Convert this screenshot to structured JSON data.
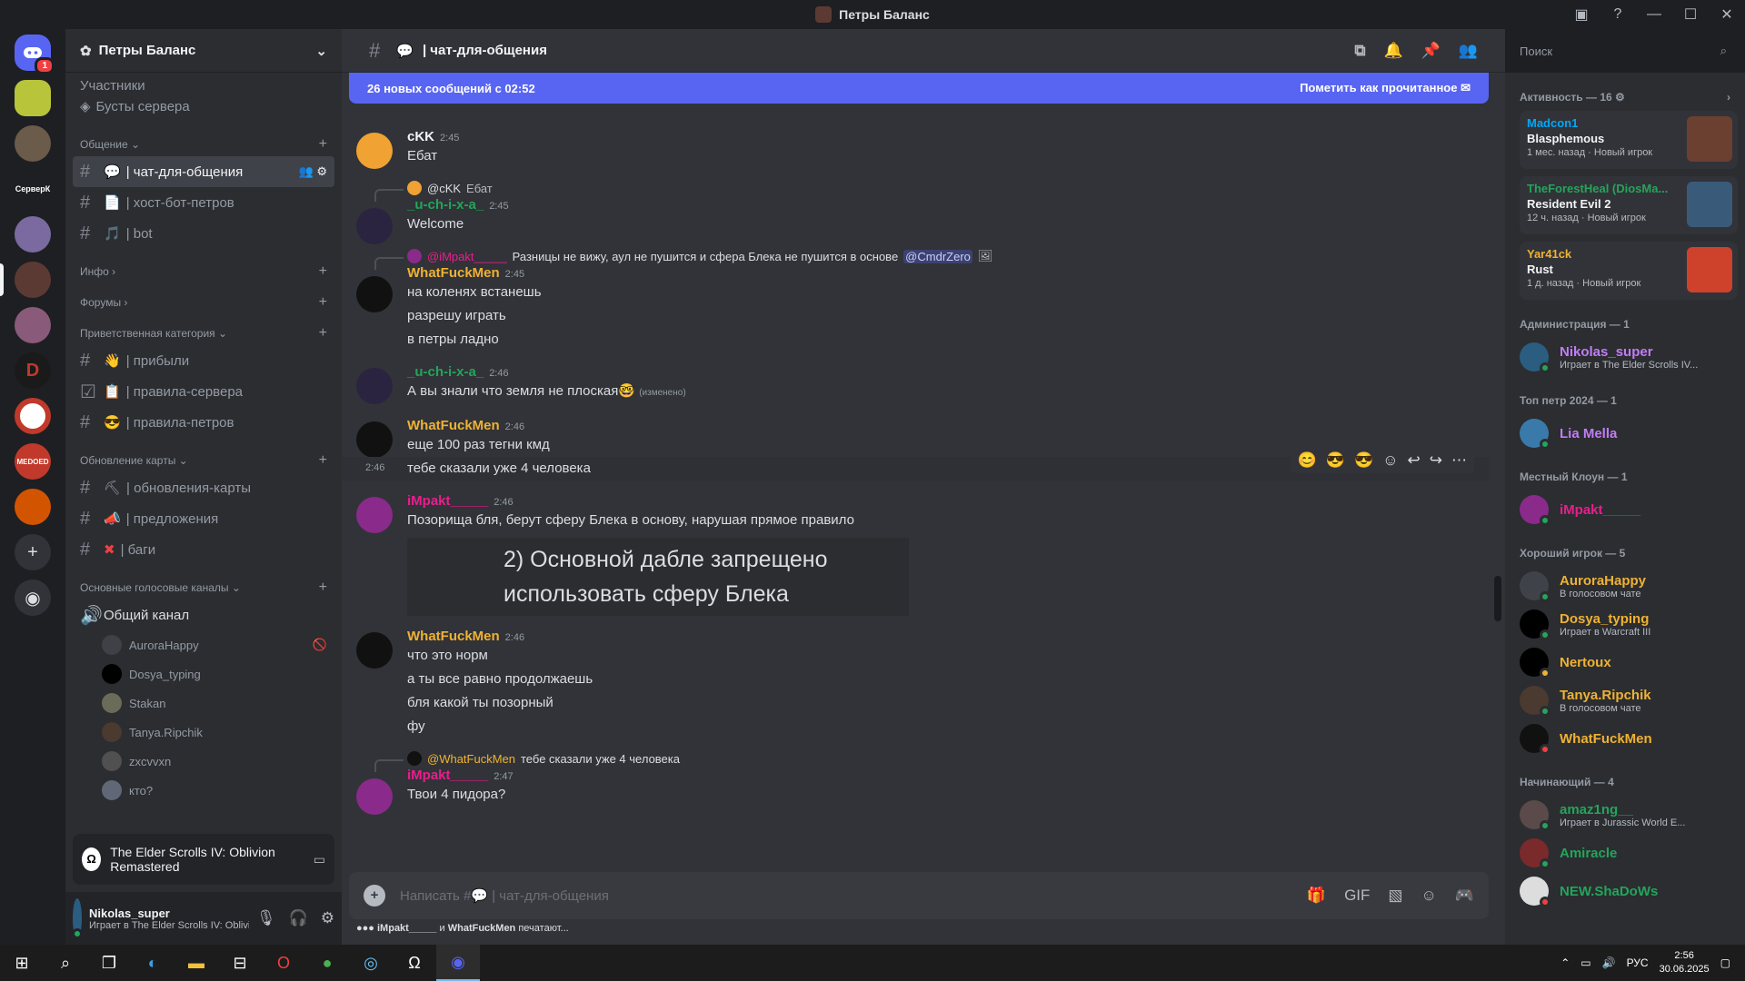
{
  "window": {
    "title": "Петры Баланс"
  },
  "guilds": [
    {
      "name": "home",
      "badge": "1"
    },
    {
      "name": "yellow-server"
    },
    {
      "name": "photo-server-1"
    },
    {
      "name": "text-server",
      "label": "СерверК"
    },
    {
      "name": "anime-server-1"
    },
    {
      "name": "petry-balans-server"
    },
    {
      "name": "anime-server-2"
    },
    {
      "name": "diablo-server"
    },
    {
      "name": "circle-server"
    },
    {
      "name": "medoed-server"
    },
    {
      "name": "red-server"
    }
  ],
  "sidebar": {
    "server_name": "Петры Баланс",
    "boosts": "Бусты сервера",
    "truncated_top": "Участники",
    "categories": {
      "obshenie": "Общение",
      "info": "Инфо",
      "forums": "Форумы",
      "welcome": "Приветственная категория",
      "map_updates": "Обновление карты",
      "voice": "Основные голосовые каналы"
    },
    "channels": {
      "chat": "| чат-для-общения",
      "host_bot": "| хост-бот-петров",
      "bot": "| bot",
      "arrived": "| прибыли",
      "server_rules": "| правила-сервера",
      "petr_rules": "| правила-петров",
      "map_updates": "| обновления-карты",
      "suggestions": "| предложения",
      "bugs": "| баги",
      "general_voice": "Общий канал"
    },
    "voice_users": [
      "AuroraHappy",
      "Dosya_typing",
      "Stakan",
      "Tanya.Ripchik",
      "zxcvvxn",
      "кто?"
    ],
    "activity": "The Elder Scrolls IV: Oblivion Remastered",
    "user": {
      "name": "Nikolas_super",
      "status": "Играет в The Elder Scrolls IV: Oblivion Remastered"
    }
  },
  "chat": {
    "channel": "| чат-для-общения",
    "banner": "26 новых сообщений с 02:52",
    "mark_read": "Пометить как прочитанное",
    "placeholder": "Написать #💬 | чат-для-общения",
    "typing_users": "iMpakt_____",
    "typing_and": "и",
    "typing_user2": "WhatFuckMen",
    "typing_suffix": "печатают...",
    "messages": [
      {
        "author": "cKK",
        "color": "#f2f3f5",
        "time": "2:45",
        "lines": [
          "Ебат"
        ]
      },
      {
        "reply_to": "@cKK",
        "reply_text": "Ебат",
        "author": "_u-ch-i-x-a_",
        "color": "#23a55a",
        "time": "2:45",
        "lines": [
          "Welcome"
        ]
      },
      {
        "reply_to": "@iMpakt_____",
        "reply_text": "Разницы не вижу, аул не пушится и сфера Блека не пушится в основе",
        "reply_mention": "@CmdrZero",
        "author": "WhatFuckMen",
        "color": "#f0b232",
        "time": "2:45",
        "lines": [
          "на коленях встанешь",
          "разрешу играть",
          "в петры ладно"
        ]
      },
      {
        "author": "_u-ch-i-x-a_",
        "color": "#23a55a",
        "time": "2:46",
        "lines": [
          "А вы знали что земля не плоская🤓"
        ],
        "edited": "(изменено)"
      },
      {
        "author": "WhatFuckMen",
        "color": "#f0b232",
        "time": "2:46",
        "lines": [
          "еще 100 раз тегни кмд"
        ],
        "extra_time": "2:46",
        "extra_line": "тебе сказали уже 4 человека"
      },
      {
        "author": "iMpakt_____",
        "color": "#e91e8c",
        "time": "2:46",
        "lines": [
          "Позорища бля, берут сферу Блека в основу, нарушая прямое правило"
        ],
        "image_text": [
          "2) Основной дабле запрещено",
          "использовать сферу Блека"
        ]
      },
      {
        "author": "WhatFuckMen",
        "color": "#f0b232",
        "time": "2:46",
        "lines": [
          "что это норм",
          "а ты все равно продолжаешь",
          "бля какой ты позорный",
          "фу"
        ]
      },
      {
        "reply_to": "@WhatFuckMen",
        "reply_text": "тебе сказали уже 4 человека",
        "author": "iMpakt_____",
        "color": "#e91e8c",
        "time": "2:47",
        "lines": [
          "Твои 4 пидора?"
        ]
      }
    ]
  },
  "search": {
    "placeholder": "Поиск"
  },
  "members": {
    "activity_header": "Активность — 16",
    "activities": [
      {
        "who": "Madcon1",
        "color": "#00a8fc",
        "game": "Blasphemous",
        "meta": "1 мес. назад",
        "tag": "Новый игрок"
      },
      {
        "who": "TheForestHeal (DiosMa...",
        "color": "#23a55a",
        "game": "Resident Evil 2",
        "meta": "12 ч. назад",
        "tag": "Новый игрок"
      },
      {
        "who": "Yar41ck",
        "color": "#f0b232",
        "game": "Rust",
        "meta": "1 д. назад",
        "tag": "Новый игрок"
      }
    ],
    "groups": [
      {
        "title": "Администрация — 1",
        "members": [
          {
            "name": "Nikolas_super",
            "color": "#c27c0e",
            "sub": "Играет в The Elder Scrolls IV..."
          }
        ]
      },
      {
        "title": "Топ петр 2024 — 1",
        "members": [
          {
            "name": "Lia Mella",
            "color": "#c27cf6",
            "sub": ""
          }
        ]
      },
      {
        "title": "Местный Клоун — 1",
        "members": [
          {
            "name": "iMpakt_____",
            "color": "#e91e8c",
            "sub": ""
          }
        ]
      },
      {
        "title": "Хороший игрок — 5",
        "members": [
          {
            "name": "AuroraHappy",
            "color": "#f0b232",
            "sub": "В голосовом чате"
          },
          {
            "name": "Dosya_typing",
            "color": "#f0b232",
            "sub": "Играет в Warcraft III"
          },
          {
            "name": "Nertoux",
            "color": "#f0b232",
            "sub": ""
          },
          {
            "name": "Tanya.Ripchik",
            "color": "#f0b232",
            "sub": "В голосовом чате"
          },
          {
            "name": "WhatFuckMen",
            "color": "#f0b232",
            "sub": ""
          }
        ]
      },
      {
        "title": "Начинающий — 4",
        "members": [
          {
            "name": "amaz1ng__",
            "color": "#23a55a",
            "sub": "Играет в Jurassic World E..."
          },
          {
            "name": "Amiracle",
            "color": "#23a55a",
            "sub": ""
          },
          {
            "name": "NEW.ShaDoWs",
            "color": "#23a55a",
            "sub": ""
          }
        ]
      }
    ]
  },
  "taskbar": {
    "lang": "РУС",
    "time": "2:56",
    "date": "30.06.2025"
  }
}
